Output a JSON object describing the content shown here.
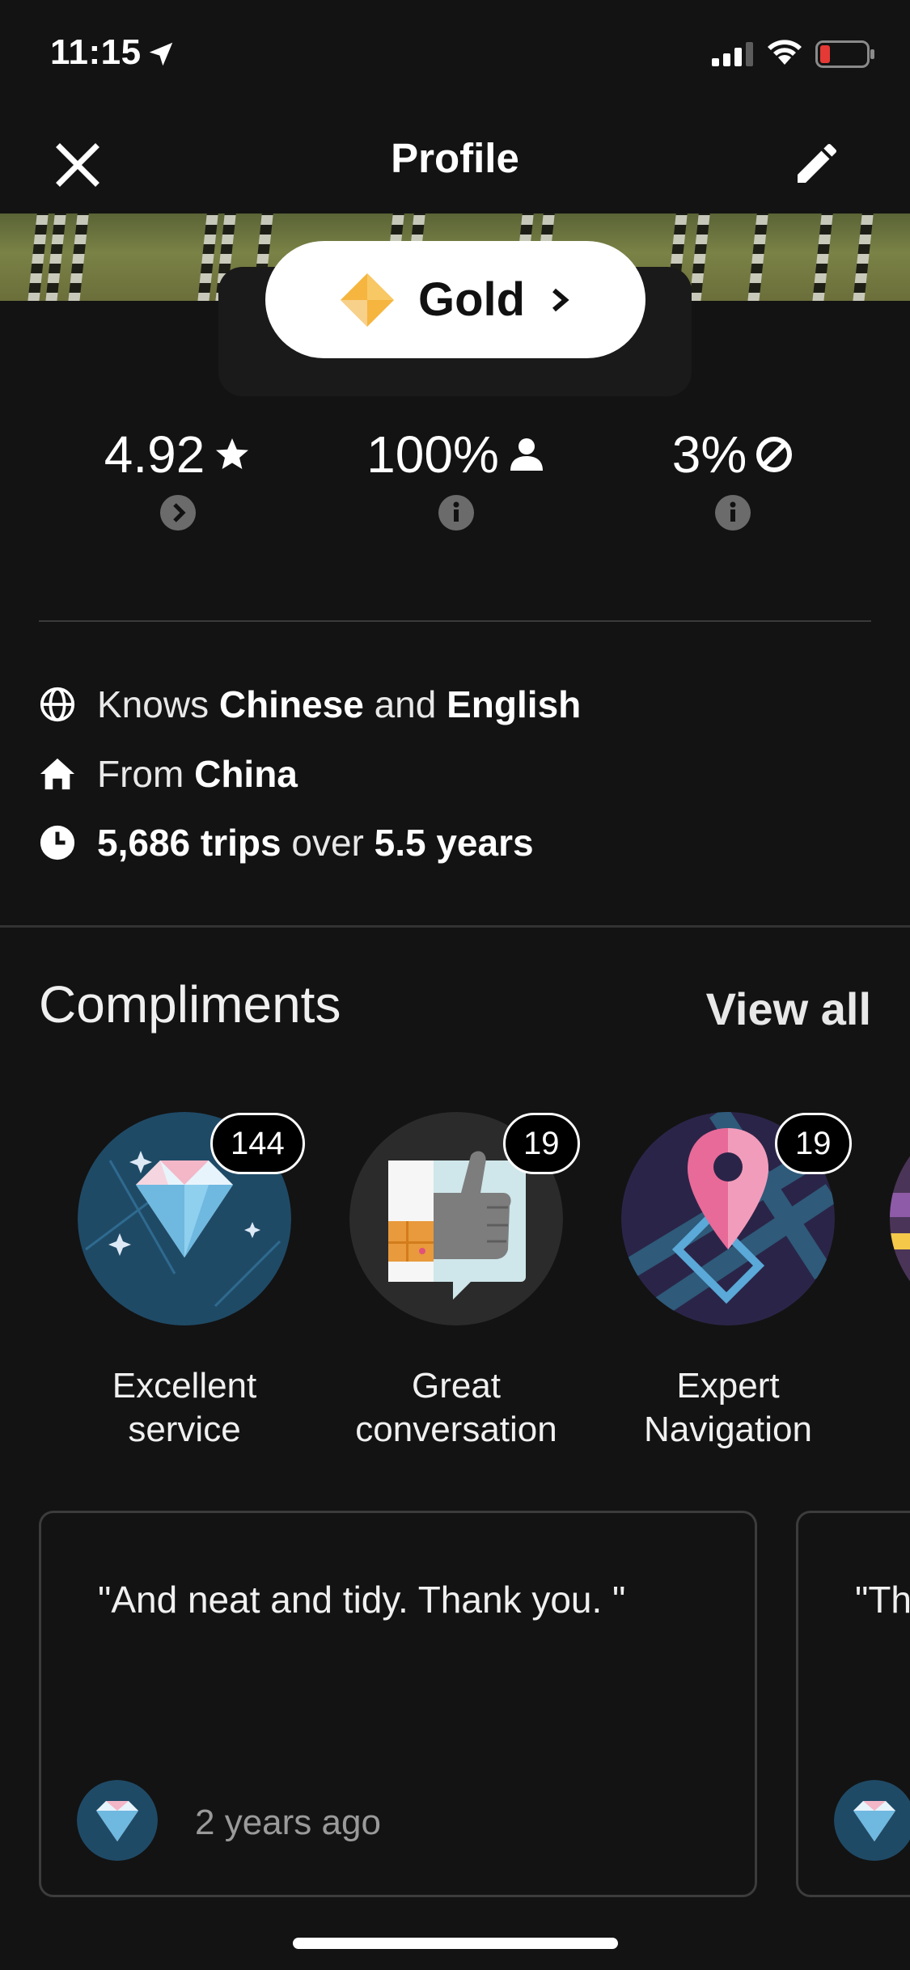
{
  "status_bar": {
    "time": "11:15",
    "icons": [
      "location-arrow-icon",
      "signal-icon",
      "wifi-icon",
      "battery-low-icon"
    ],
    "battery_color": "#e53935"
  },
  "nav": {
    "title": "Profile",
    "close_icon": "close-icon",
    "edit_icon": "pencil-icon"
  },
  "tier": {
    "label": "Gold",
    "icon": "gold-diamond-icon",
    "color": "#f5b53f"
  },
  "stats": [
    {
      "value": "4.92",
      "icon": "star-icon",
      "action_icon": "chevron-right-circle-icon"
    },
    {
      "value": "100%",
      "icon": "person-icon",
      "action_icon": "info-icon"
    },
    {
      "value": "3%",
      "icon": "cancel-icon",
      "action_icon": "info-icon"
    }
  ],
  "facts": {
    "languages": {
      "prefix": "Knows",
      "lang1": "Chinese",
      "joiner": "and",
      "lang2": "English"
    },
    "origin": {
      "prefix": "From",
      "place": "China"
    },
    "trips": {
      "count": "5,686 trips",
      "joiner": "over",
      "duration": "5.5 years"
    }
  },
  "compliments": {
    "title": "Compliments",
    "view_all": "View all",
    "items": [
      {
        "count": "144",
        "label_line1": "Excellent",
        "label_line2": "service",
        "icon": "diamond-badge-icon"
      },
      {
        "count": "19",
        "label_line1": "Great",
        "label_line2": "conversation",
        "icon": "thumbs-up-badge-icon"
      },
      {
        "count": "19",
        "label_line1": "Expert",
        "label_line2": "Navigation",
        "icon": "map-pin-badge-icon"
      }
    ]
  },
  "reviews": [
    {
      "text": "\"And neat and tidy. Thank you. \"",
      "time": "2 years ago"
    },
    {
      "text": "\"Th",
      "time": ""
    }
  ]
}
